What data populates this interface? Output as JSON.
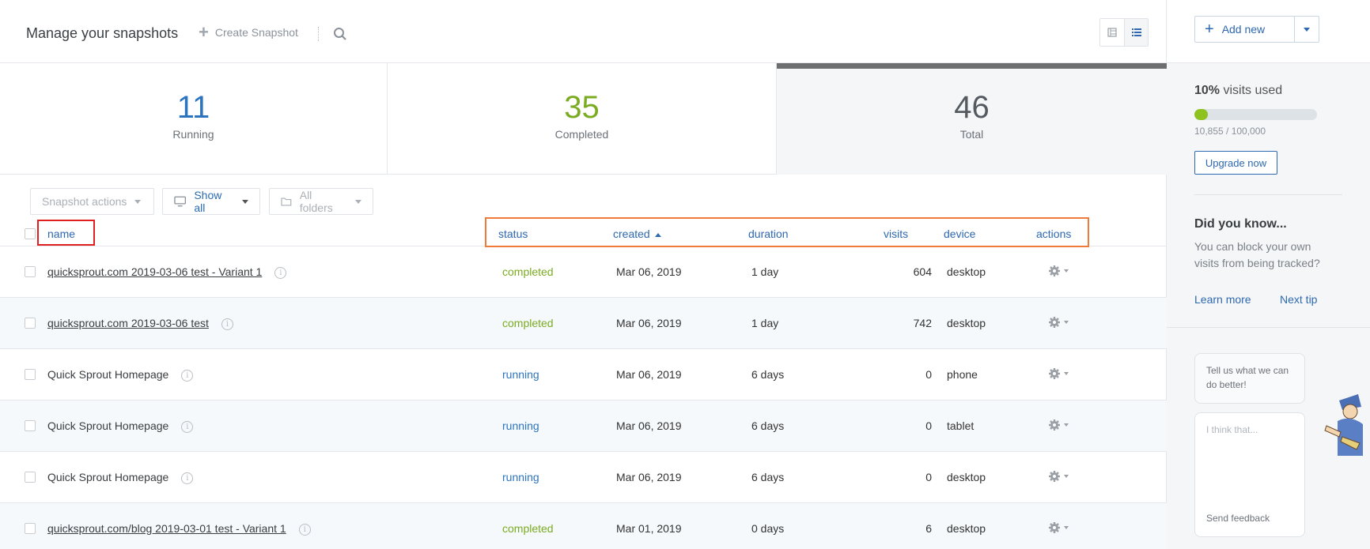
{
  "header": {
    "title": "Manage your snapshots",
    "create_label": "Create Snapshot"
  },
  "stats": {
    "running": {
      "value": "11",
      "label": "Running",
      "color": "#2d74c0"
    },
    "completed": {
      "value": "35",
      "label": "Completed",
      "color": "#7aab21"
    },
    "total": {
      "value": "46",
      "label": "Total",
      "color": "#555a60"
    }
  },
  "filters": {
    "snapshot_actions": "Snapshot actions",
    "show_all": "Show all",
    "all_folders": "All folders"
  },
  "table": {
    "columns": {
      "name": "name",
      "status": "status",
      "created": "created",
      "duration": "duration",
      "visits": "visits",
      "device": "device",
      "actions": "actions"
    },
    "rows": [
      {
        "name": "quicksprout.com 2019-03-06 test - Variant 1",
        "link": true,
        "status": "completed",
        "created": "Mar 06, 2019",
        "duration": "1 day",
        "visits": "604",
        "device": "desktop"
      },
      {
        "name": "quicksprout.com 2019-03-06 test",
        "link": true,
        "status": "completed",
        "created": "Mar 06, 2019",
        "duration": "1 day",
        "visits": "742",
        "device": "desktop"
      },
      {
        "name": "Quick Sprout Homepage",
        "link": false,
        "status": "running",
        "created": "Mar 06, 2019",
        "duration": "6 days",
        "visits": "0",
        "device": "phone"
      },
      {
        "name": "Quick Sprout Homepage",
        "link": false,
        "status": "running",
        "created": "Mar 06, 2019",
        "duration": "6 days",
        "visits": "0",
        "device": "tablet"
      },
      {
        "name": "Quick Sprout Homepage",
        "link": false,
        "status": "running",
        "created": "Mar 06, 2019",
        "duration": "6 days",
        "visits": "0",
        "device": "desktop"
      },
      {
        "name": "quicksprout.com/blog 2019-03-01 test - Variant 1",
        "link": true,
        "status": "completed",
        "created": "Mar 01, 2019",
        "duration": "0 days",
        "visits": "6",
        "device": "desktop"
      }
    ]
  },
  "sidebar": {
    "add_new_label": "Add new",
    "usage_percent": "10%",
    "usage_label": "visits used",
    "usage_fraction": 0.1085,
    "usage_count": "10,855 / 100,000",
    "upgrade_label": "Upgrade now",
    "tip_title": "Did you know...",
    "tip_body": "You can block your own visits from being tracked?",
    "learn_more": "Learn more",
    "next_tip": "Next tip",
    "feedback_prompt": "Tell us what we can do better!",
    "feedback_placeholder": "I think that...",
    "send_feedback": "Send feedback"
  }
}
